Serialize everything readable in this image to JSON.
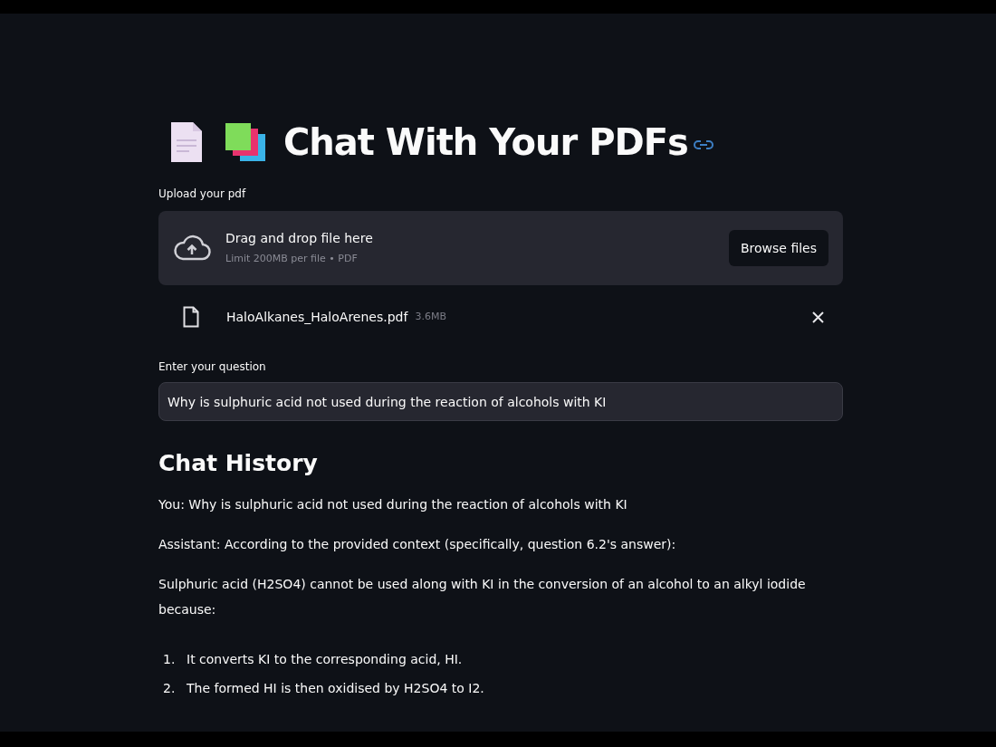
{
  "title": "Chat With Your PDFs",
  "uploader": {
    "label": "Upload your pdf",
    "dropzone_text": "Drag and drop file here",
    "limit_text": "Limit 200MB per file • PDF",
    "button": "Browse files"
  },
  "uploaded_file": {
    "name": "HaloAlkanes_HaloArenes.pdf",
    "size": "3.6MB"
  },
  "question": {
    "label": "Enter your question",
    "value": "Why is sulphuric acid not used during the reaction of alcohols with KI"
  },
  "chat_history": {
    "heading": "Chat History",
    "paragraphs": [
      "You: Why is sulphuric acid not used during the reaction of alcohols with KI",
      "Assistant: According to the provided context (specifically, question 6.2's answer):",
      "Sulphuric acid (H2SO4) cannot be used along with KI in the conversion of an alcohol to an alkyl iodide because:"
    ],
    "list": [
      {
        "number": "1.",
        "text": "It converts KI to the corresponding acid, HI."
      },
      {
        "number": "2.",
        "text": "The formed HI is then oxidised by H2SO4 to I2."
      }
    ]
  }
}
